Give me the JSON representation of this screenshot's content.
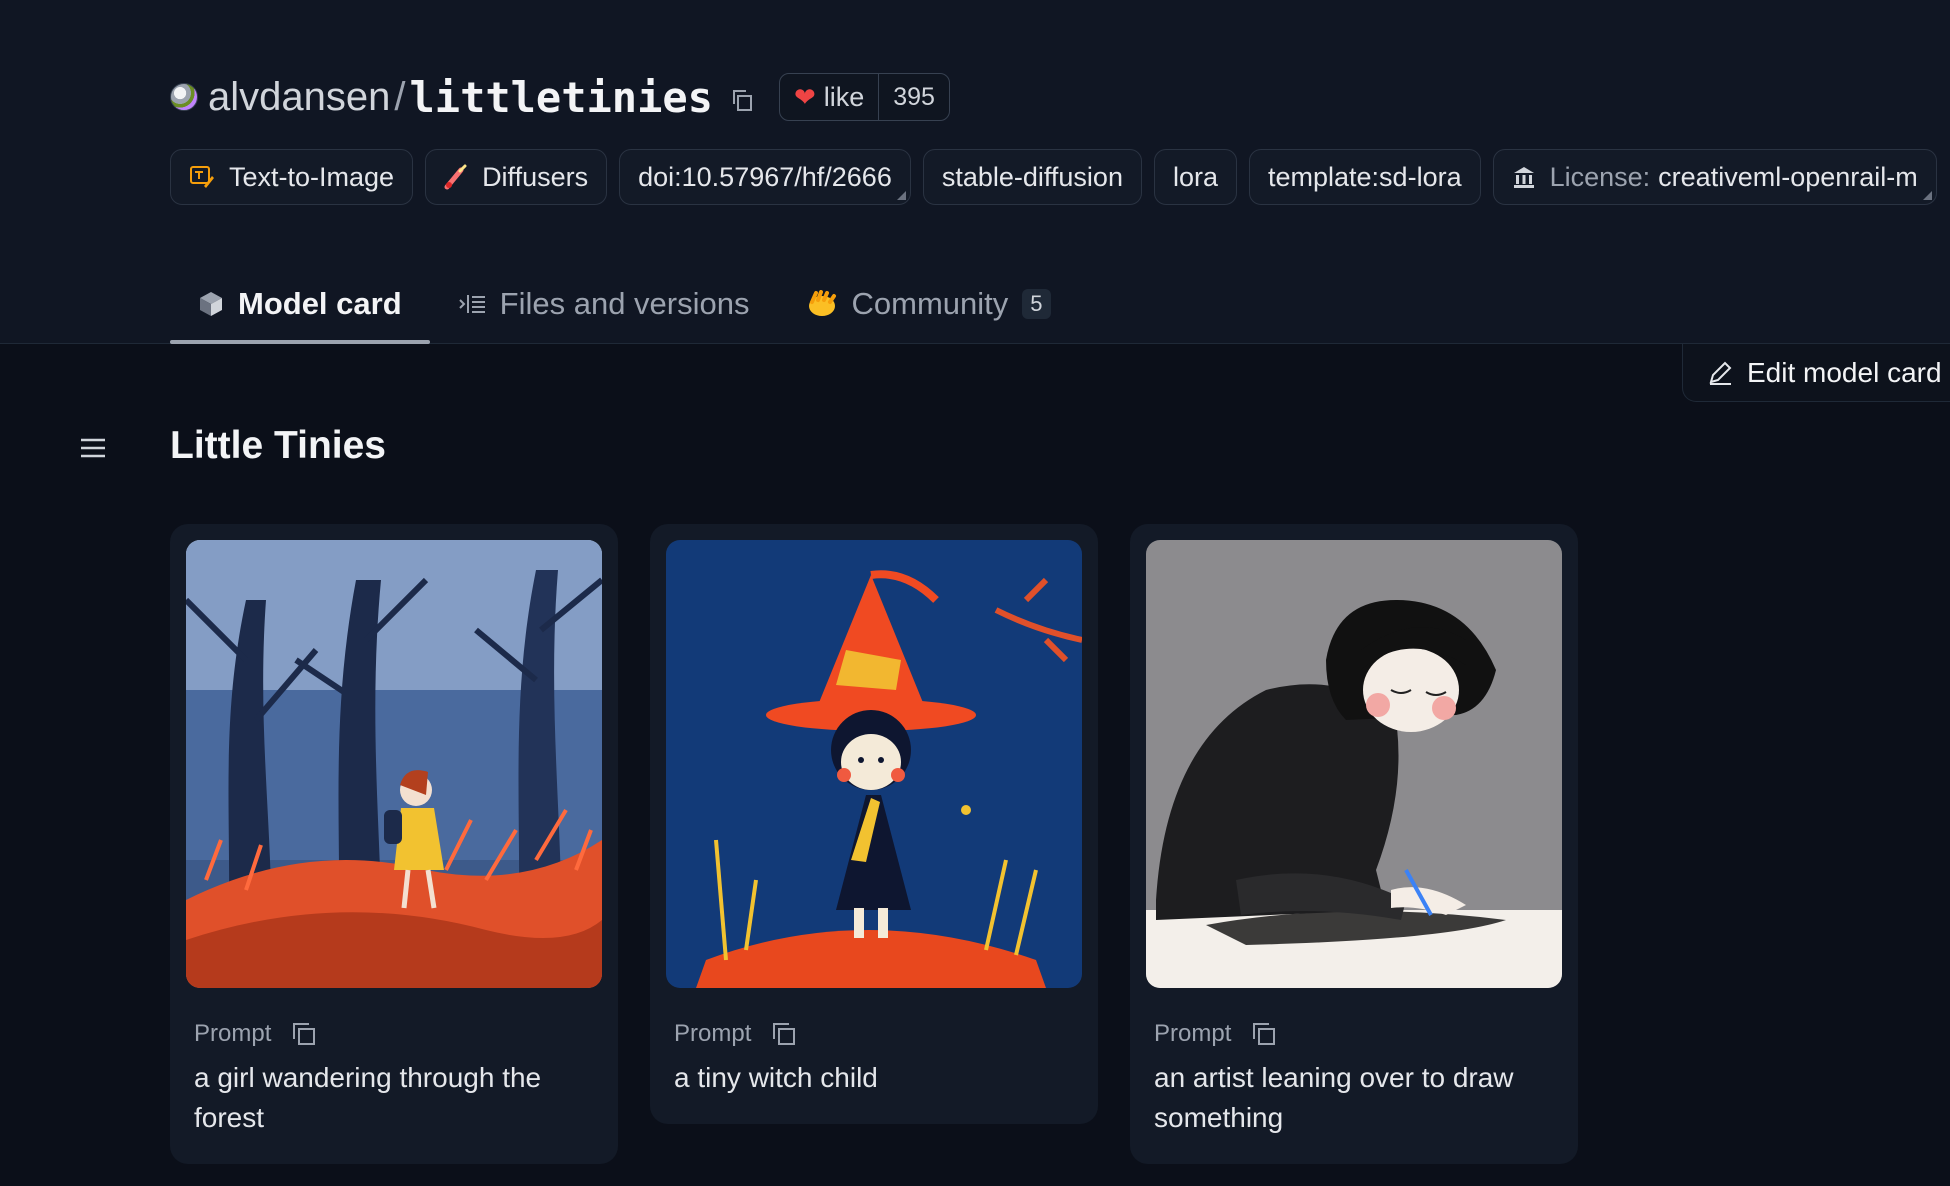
{
  "repo": {
    "owner": "alvdansen",
    "separator": "/",
    "name": "littletinies",
    "like_label": "like",
    "like_count": "395"
  },
  "tags": [
    {
      "id": "text-to-image",
      "label": "Text-to-Image",
      "icon": "text-to-image-icon"
    },
    {
      "id": "diffusers",
      "label": "Diffusers",
      "icon": "diffusers-icon"
    },
    {
      "id": "doi",
      "label": "doi:10.57967/hf/2666"
    },
    {
      "id": "stable-diffusion",
      "label": "stable-diffusion"
    },
    {
      "id": "lora",
      "label": "lora"
    },
    {
      "id": "template",
      "label": "template:sd-lora"
    },
    {
      "id": "license",
      "prefix": "License:",
      "label": "creativeml-openrail-m",
      "icon": "license-icon"
    }
  ],
  "tabs": [
    {
      "label": "Model card",
      "icon": "model-card-icon",
      "active": true
    },
    {
      "label": "Files and versions",
      "icon": "files-icon",
      "active": false
    },
    {
      "label": "Community",
      "icon": "community-icon",
      "count": "5",
      "active": false
    }
  ],
  "edit_button": {
    "label": "Edit model card",
    "icon": "pencil-icon"
  },
  "page_title": "Little Tinies",
  "gallery": [
    {
      "prompt_label": "Prompt",
      "prompt": "a girl wandering through the forest",
      "image": "forest-girl-illustration"
    },
    {
      "prompt_label": "Prompt",
      "prompt": "a tiny witch child",
      "image": "witch-child-illustration"
    },
    {
      "prompt_label": "Prompt",
      "prompt": "an artist leaning over to draw something",
      "image": "artist-drawing-illustration"
    }
  ],
  "colors": {
    "background": "#0b0f19",
    "header_background": "#101623",
    "card_background": "#131a27",
    "heart": "#ef4444"
  }
}
